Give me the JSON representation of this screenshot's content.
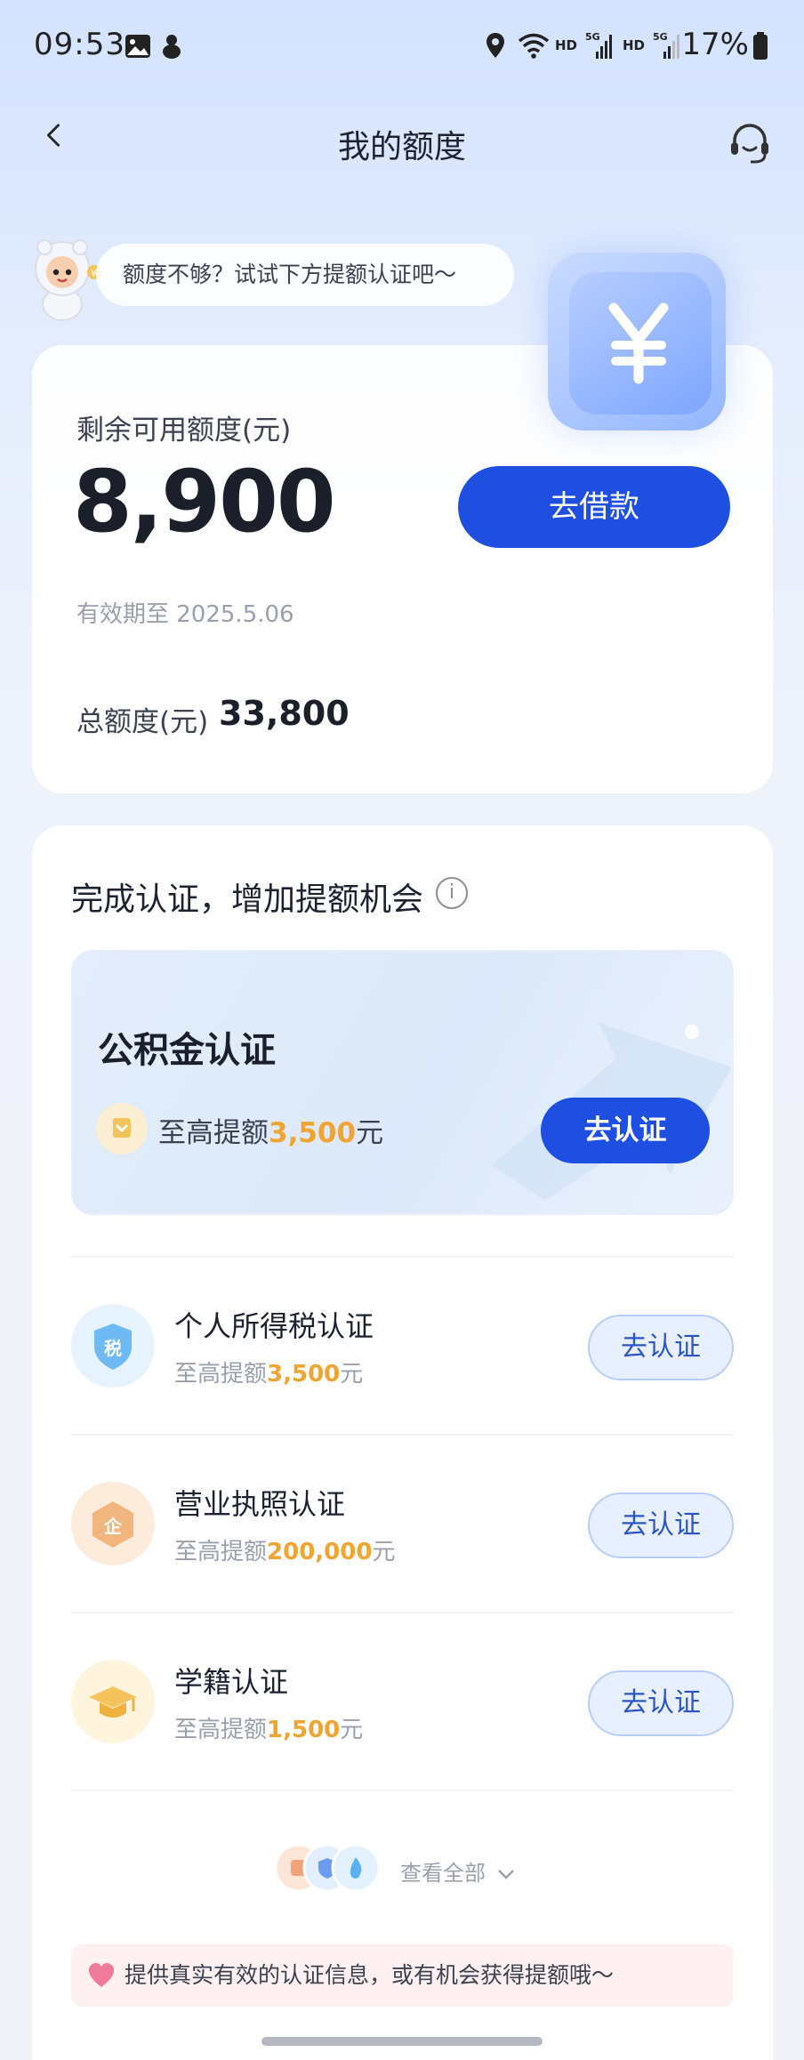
{
  "status_bar": {
    "time": "09:53",
    "hd1": "HD",
    "hd2": "HD",
    "battery": "17%"
  },
  "nav": {
    "title": "我的额度"
  },
  "mascot": {
    "bubble_text": "额度不够？试试下方提额认证吧～"
  },
  "quota": {
    "available_label": "剩余可用额度(元)",
    "available_amount": "8,900",
    "borrow_button": "去借款",
    "validity": "有效期至 2025.5.06",
    "total_label": "总额度(元)",
    "total_amount": "33,800"
  },
  "certification": {
    "heading": "完成认证，增加提额机会",
    "featured": {
      "title": "公积金认证",
      "sub_prefix": "至高提额",
      "sub_amount": "3,500",
      "sub_suffix": "元",
      "button": "去认证"
    },
    "items": [
      {
        "title": "个人所得税认证",
        "sub_prefix": "至高提额",
        "sub_amount": "3,500",
        "sub_suffix": "元",
        "button": "去认证",
        "icon": "tax-shield-icon",
        "icon_char": "税"
      },
      {
        "title": "营业执照认证",
        "sub_prefix": "至高提额",
        "sub_amount": "200,000",
        "sub_suffix": "元",
        "button": "去认证",
        "icon": "business-license-icon",
        "icon_char": "企"
      },
      {
        "title": "学籍认证",
        "sub_prefix": "至高提额",
        "sub_amount": "1,500",
        "sub_suffix": "元",
        "button": "去认证",
        "icon": "graduation-cap-icon"
      }
    ],
    "view_all": "查看全部"
  },
  "notice": {
    "text": "提供真实有效的认证信息，或有机会获得提额哦～"
  },
  "colors": {
    "primary": "#1f4fe0",
    "highlight": "#f0a431",
    "outline_button_bg": "#e8f0ff"
  }
}
